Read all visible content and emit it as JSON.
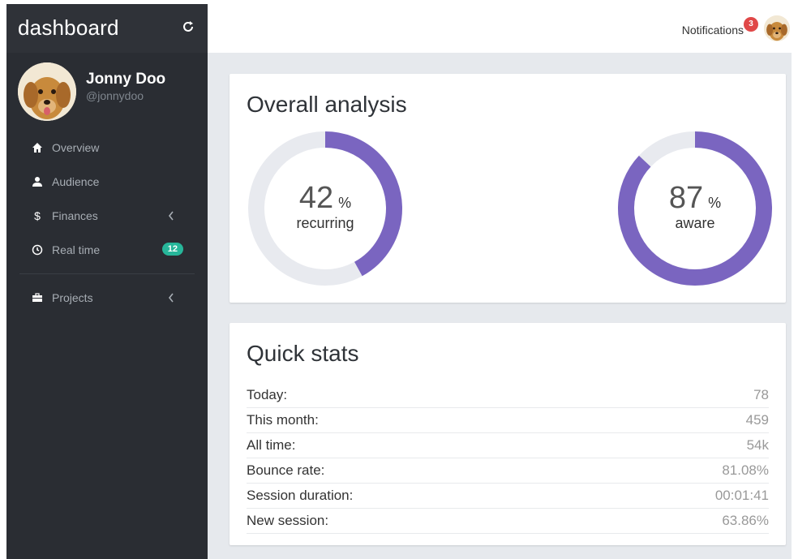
{
  "brand": "dashboard",
  "profile": {
    "name": "Jonny Doo",
    "handle": "@jonnydoo"
  },
  "nav": [
    {
      "label": "Overview",
      "icon": "home-icon"
    },
    {
      "label": "Audience",
      "icon": "user-icon"
    },
    {
      "label": "Finances",
      "icon": "dollar-icon"
    },
    {
      "label": "Real time",
      "icon": "clock-icon",
      "badge": "12"
    },
    {
      "label": "Projects",
      "icon": "briefcase-icon"
    }
  ],
  "topbar": {
    "notifications_label": "Notifications",
    "notifications_count": "3"
  },
  "analysis": {
    "title": "Overall analysis",
    "recurring": {
      "value": "42",
      "unit": "%",
      "label": "recurring",
      "fraction": 0.42
    },
    "aware": {
      "value": "87",
      "unit": "%",
      "label": "aware",
      "fraction": 0.87
    }
  },
  "quick_stats": {
    "title": "Quick stats",
    "rows": [
      {
        "label": "Today:",
        "value": "78"
      },
      {
        "label": "This month:",
        "value": "459"
      },
      {
        "label": "All time:",
        "value": "54k"
      },
      {
        "label": "Bounce rate:",
        "value": "81.08%"
      },
      {
        "label": "Session duration:",
        "value": "00:01:41"
      },
      {
        "label": "New session:",
        "value": "63.86%"
      }
    ]
  },
  "colors": {
    "accent": "#7a65c0",
    "track": "#e8eaef",
    "sidebar": "#2a2d33",
    "badge_green": "#27b69a",
    "badge_red": "#e04848"
  }
}
